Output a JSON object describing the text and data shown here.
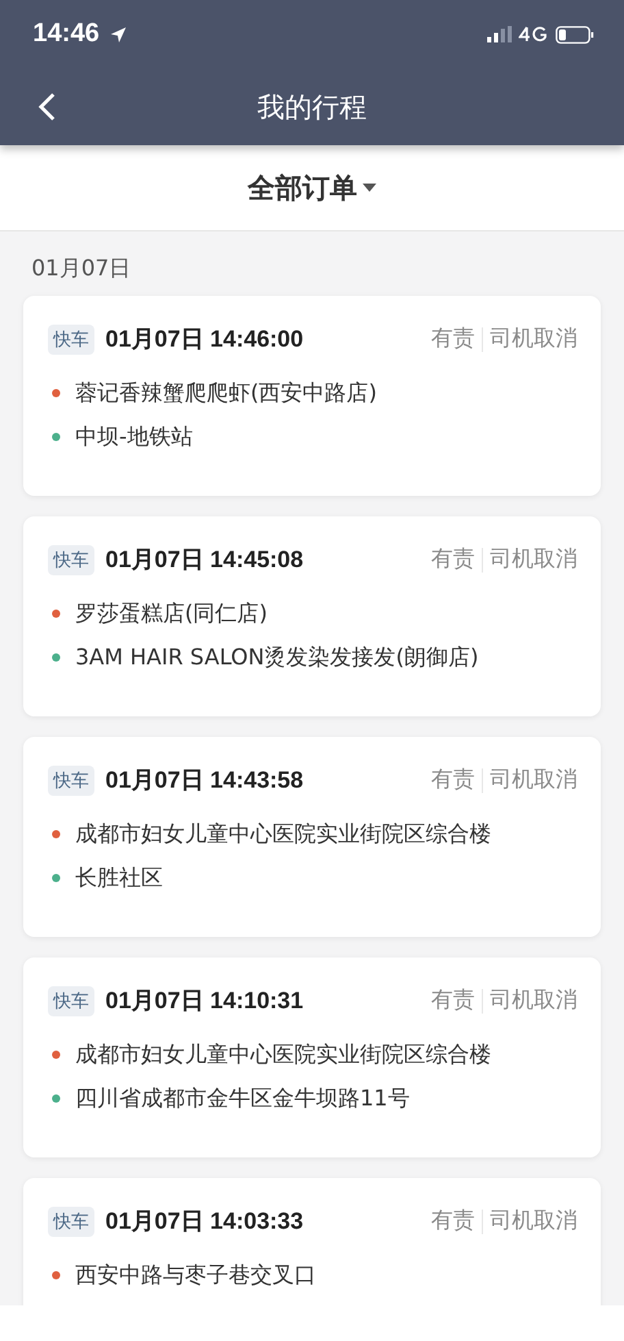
{
  "status_bar": {
    "time": "14:46"
  },
  "nav": {
    "title": "我的行程"
  },
  "filter": {
    "label": "全部订单"
  },
  "date_group": "01月07日",
  "orders": [
    {
      "tag": "快车",
      "time": "01月07日 14:46:00",
      "responsibility": "有责",
      "status": "司机取消",
      "points": [
        {
          "kind": "start",
          "name": "蓉记香辣蟹爬爬虾(西安中路店)"
        },
        {
          "kind": "end",
          "name": "中坝-地铁站"
        }
      ]
    },
    {
      "tag": "快车",
      "time": "01月07日 14:45:08",
      "responsibility": "有责",
      "status": "司机取消",
      "points": [
        {
          "kind": "start",
          "name": "罗莎蛋糕店(同仁店)"
        },
        {
          "kind": "end",
          "name": "3AM HAIR SALON烫发染发接发(朗御店)"
        }
      ]
    },
    {
      "tag": "快车",
      "time": "01月07日 14:43:58",
      "responsibility": "有责",
      "status": "司机取消",
      "points": [
        {
          "kind": "start",
          "name": "成都市妇女儿童中心医院实业街院区综合楼"
        },
        {
          "kind": "end",
          "name": "长胜社区"
        }
      ]
    },
    {
      "tag": "快车",
      "time": "01月07日 14:10:31",
      "responsibility": "有责",
      "status": "司机取消",
      "points": [
        {
          "kind": "start",
          "name": "成都市妇女儿童中心医院实业街院区综合楼"
        },
        {
          "kind": "end",
          "name": "四川省成都市金牛区金牛坝路11号"
        }
      ]
    },
    {
      "tag": "快车",
      "time": "01月07日 14:03:33",
      "responsibility": "有责",
      "status": "司机取消",
      "points": [
        {
          "kind": "start",
          "name": "西安中路与枣子巷交叉口"
        }
      ]
    }
  ]
}
